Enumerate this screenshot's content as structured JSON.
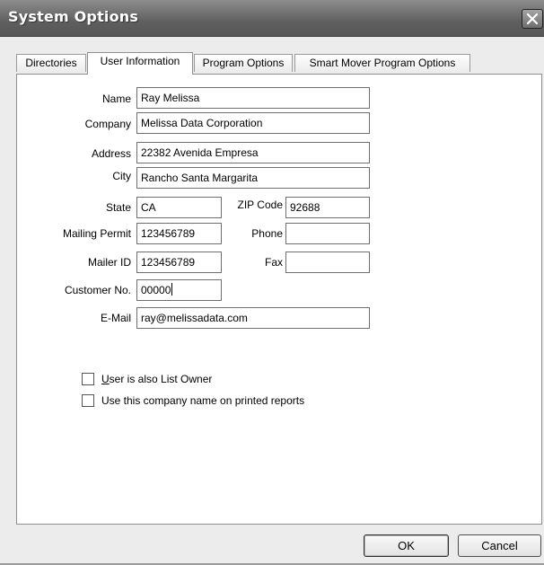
{
  "window": {
    "title": "System Options"
  },
  "tabs": [
    {
      "label": "Directories",
      "active": false
    },
    {
      "label": "User Information",
      "active": true
    },
    {
      "label": "Program Options",
      "active": false
    },
    {
      "label": "Smart Mover Program Options",
      "active": false
    }
  ],
  "form": {
    "name": {
      "label": "Name",
      "value": "Ray Melissa"
    },
    "company": {
      "label": "Company",
      "value": "Melissa Data Corporation"
    },
    "address": {
      "label": "Address",
      "value": "22382 Avenida Empresa"
    },
    "city": {
      "label": "City",
      "value": "Rancho Santa Margarita"
    },
    "state": {
      "label": "State",
      "value": "CA"
    },
    "zip": {
      "label": "ZIP Code",
      "value": "92688"
    },
    "mailing_permit": {
      "label": "Mailing Permit",
      "value": "123456789"
    },
    "phone": {
      "label": "Phone",
      "value": ""
    },
    "mailer_id": {
      "label": "Mailer ID",
      "value": "123456789"
    },
    "fax": {
      "label": "Fax",
      "value": ""
    },
    "customer_no": {
      "label": "Customer No.",
      "value": "00000"
    },
    "email": {
      "label": "E-Mail",
      "value": "ray@melissadata.com"
    }
  },
  "checkboxes": [
    {
      "label_underlined": "U",
      "label_rest": "ser is also List Owner",
      "checked": false
    },
    {
      "label_underlined": "",
      "label_rest": "Use this company name on printed reports",
      "checked": false
    }
  ],
  "buttons": {
    "ok": "OK",
    "cancel": "Cancel"
  },
  "icons": {
    "close": "close-icon"
  }
}
